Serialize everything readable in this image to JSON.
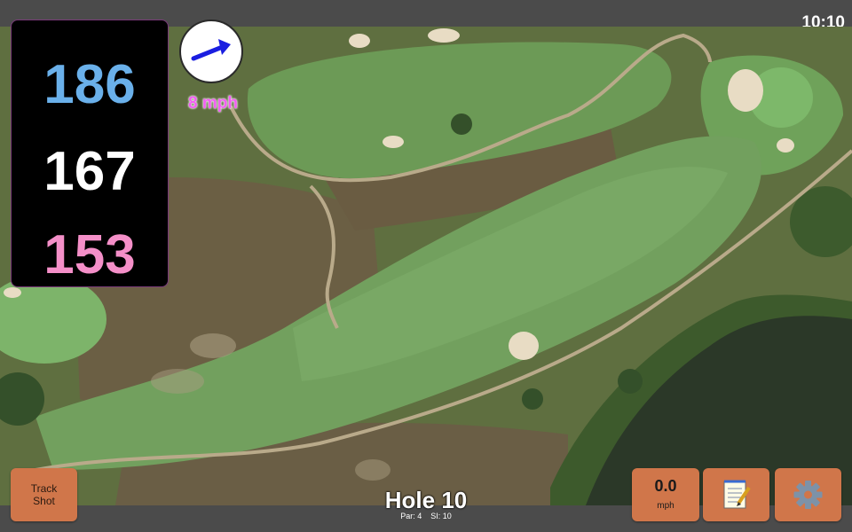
{
  "status_bar": {
    "time": "10:10"
  },
  "distances": {
    "back": "186",
    "middle": "167",
    "front": "153",
    "back_color": "#6ab0ea",
    "middle_color": "#ffffff",
    "front_color": "#f48fc8"
  },
  "wind": {
    "speed_label": "8 mph",
    "direction_icon": "arrow-icon",
    "arrow_color": "#1a1ee0"
  },
  "hole": {
    "title": "Hole 10",
    "par_label": "Par: 4",
    "si_label": "SI: 10"
  },
  "buttons": {
    "track_shot": "Track\nShot",
    "wind_value": "0.0",
    "wind_unit": "mph",
    "notes_icon": "notepad-icon",
    "settings_icon": "gear-icon",
    "color": "#d0764a"
  },
  "map": {
    "type": "satellite",
    "features": [
      "fairway",
      "bunkers",
      "cart-path",
      "water-hazard",
      "green"
    ]
  }
}
